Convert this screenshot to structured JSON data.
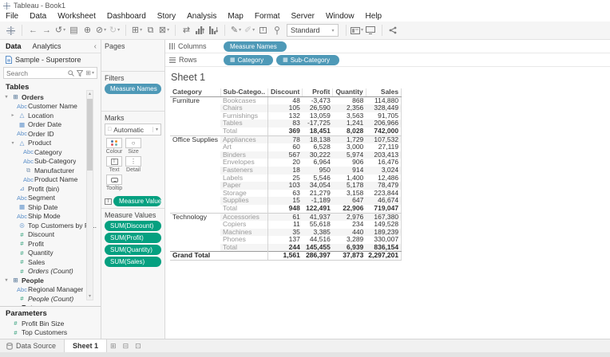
{
  "window": {
    "title": "Tableau - Book1"
  },
  "menu": [
    "File",
    "Data",
    "Worksheet",
    "Dashboard",
    "Story",
    "Analysis",
    "Map",
    "Format",
    "Server",
    "Window",
    "Help"
  ],
  "toolbar": {
    "view_select": "Standard"
  },
  "data_pane": {
    "tab_data": "Data",
    "tab_analytics": "Analytics",
    "datasource": "Sample - Superstore",
    "search_placeholder": "Search",
    "tables_label": "Tables",
    "fields": [
      {
        "icon": "table",
        "label": "Orders",
        "indent": 0,
        "bold": true,
        "expander": "open"
      },
      {
        "icon": "abc",
        "label": "Customer Name",
        "indent": 1
      },
      {
        "icon": "geo",
        "label": "Location",
        "indent": 1,
        "expander": "closed"
      },
      {
        "icon": "calendar",
        "label": "Order Date",
        "indent": 1
      },
      {
        "icon": "abc",
        "label": "Order ID",
        "indent": 1
      },
      {
        "icon": "geo",
        "label": "Product",
        "indent": 1,
        "expander": "open"
      },
      {
        "icon": "abc",
        "label": "Category",
        "indent": 2
      },
      {
        "icon": "abc",
        "label": "Sub-Category",
        "indent": 2
      },
      {
        "icon": "link",
        "label": "Manufacturer",
        "indent": 2
      },
      {
        "icon": "abc",
        "label": "Product Name",
        "indent": 2
      },
      {
        "icon": "bin",
        "label": "Profit (bin)",
        "indent": 1
      },
      {
        "icon": "abc",
        "label": "Segment",
        "indent": 1
      },
      {
        "icon": "calendar",
        "label": "Ship Date",
        "indent": 1
      },
      {
        "icon": "abc",
        "label": "Ship Mode",
        "indent": 1
      },
      {
        "icon": "set",
        "label": "Top Customers by Pr...",
        "indent": 1
      },
      {
        "icon": "num",
        "label": "Discount",
        "indent": 1
      },
      {
        "icon": "num",
        "label": "Profit",
        "indent": 1
      },
      {
        "icon": "num",
        "label": "Quantity",
        "indent": 1
      },
      {
        "icon": "num",
        "label": "Sales",
        "indent": 1
      },
      {
        "icon": "num",
        "label": "Orders (Count)",
        "indent": 1,
        "italic": true
      },
      {
        "icon": "table",
        "label": "People",
        "indent": 0,
        "bold": true,
        "expander": "open"
      },
      {
        "icon": "abc",
        "label": "Regional Manager",
        "indent": 1
      },
      {
        "icon": "num",
        "label": "People (Count)",
        "indent": 1,
        "italic": true
      },
      {
        "icon": "table",
        "label": "Returns",
        "indent": 0,
        "bold": true
      }
    ],
    "parameters_label": "Parameters",
    "parameters": [
      {
        "icon": "num",
        "label": "Profit Bin Size"
      },
      {
        "icon": "num",
        "label": "Top Customers"
      }
    ]
  },
  "cards": {
    "pages_label": "Pages",
    "filters_label": "Filters",
    "filter_pills": [
      "Measure Names"
    ],
    "marks_label": "Marks",
    "mark_type": "Automatic",
    "mark_buttons": [
      {
        "icon": "colour",
        "label": "Colour"
      },
      {
        "icon": "size",
        "label": "Size"
      },
      {
        "icon": "text",
        "label": "Text"
      },
      {
        "icon": "detail",
        "label": "Detail"
      },
      {
        "icon": "tooltip",
        "label": "Tooltip"
      }
    ],
    "marks_pill": "Measure Values",
    "measure_values_label": "Measure Values",
    "measure_pills": [
      "SUM(Discount)",
      "SUM(Profit)",
      "SUM(Quantity)",
      "SUM(Sales)"
    ]
  },
  "shelves": {
    "columns_label": "Columns",
    "columns_pills": [
      {
        "label": "Measure Names",
        "icon": false
      }
    ],
    "rows_label": "Rows",
    "rows_pills": [
      {
        "label": "Category",
        "icon": true
      },
      {
        "label": "Sub-Category",
        "icon": true
      }
    ]
  },
  "sheet": {
    "title": "Sheet 1"
  },
  "table": {
    "headers": [
      "Category",
      "Sub-Catego..",
      "Discount",
      "Profit",
      "Quantity",
      "Sales"
    ],
    "sections": [
      {
        "category": "Furniture",
        "rows": [
          [
            "Bookcases",
            "48",
            "-3,473",
            "868",
            "114,880"
          ],
          [
            "Chairs",
            "105",
            "26,590",
            "2,356",
            "328,449"
          ],
          [
            "Furnishings",
            "132",
            "13,059",
            "3,563",
            "91,705"
          ],
          [
            "Tables",
            "83",
            "-17,725",
            "1,241",
            "206,966"
          ],
          [
            "Total",
            "369",
            "18,451",
            "8,028",
            "742,000"
          ]
        ]
      },
      {
        "category": "Office Supplies",
        "rows": [
          [
            "Appliances",
            "78",
            "18,138",
            "1,729",
            "107,532"
          ],
          [
            "Art",
            "60",
            "6,528",
            "3,000",
            "27,119"
          ],
          [
            "Binders",
            "567",
            "30,222",
            "5,974",
            "203,413"
          ],
          [
            "Envelopes",
            "20",
            "6,964",
            "906",
            "16,476"
          ],
          [
            "Fasteners",
            "18",
            "950",
            "914",
            "3,024"
          ],
          [
            "Labels",
            "25",
            "5,546",
            "1,400",
            "12,486"
          ],
          [
            "Paper",
            "103",
            "34,054",
            "5,178",
            "78,479"
          ],
          [
            "Storage",
            "63",
            "21,279",
            "3,158",
            "223,844"
          ],
          [
            "Supplies",
            "15",
            "-1,189",
            "647",
            "46,674"
          ],
          [
            "Total",
            "948",
            "122,491",
            "22,906",
            "719,047"
          ]
        ]
      },
      {
        "category": "Technology",
        "rows": [
          [
            "Accessories",
            "61",
            "41,937",
            "2,976",
            "167,380"
          ],
          [
            "Copiers",
            "11",
            "55,618",
            "234",
            "149,528"
          ],
          [
            "Machines",
            "35",
            "3,385",
            "440",
            "189,239"
          ],
          [
            "Phones",
            "137",
            "44,516",
            "3,289",
            "330,007"
          ],
          [
            "Total",
            "244",
            "145,455",
            "6,939",
            "836,154"
          ]
        ]
      }
    ],
    "grand_total": {
      "label": "Grand Total",
      "values": [
        "1,561",
        "286,397",
        "37,873",
        "2,297,201"
      ]
    }
  },
  "status_bar": {
    "datasource_tab": "Data Source",
    "sheet_tab": "Sheet 1"
  },
  "colors": {
    "pill_blue": "#4E99B7",
    "pill_green": "#05A080",
    "dimension_blue": "#5B8FC9",
    "measure_green": "#2E9E78",
    "mark_dot_colors": [
      "#4e79a7",
      "#f28e2b",
      "#e15759",
      "#76b7b2"
    ]
  }
}
